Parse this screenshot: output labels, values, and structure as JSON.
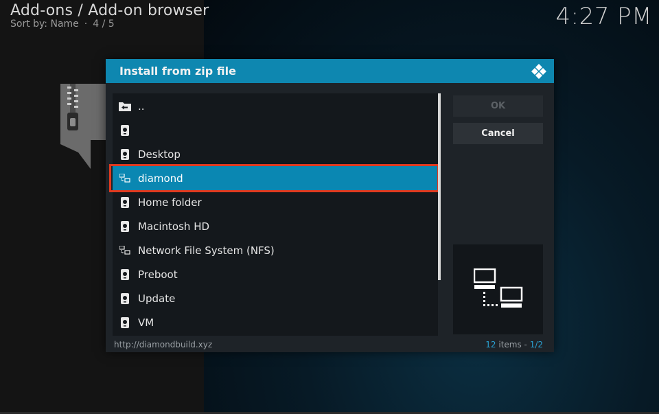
{
  "header": {
    "title": "Add-ons / Add-on browser",
    "sort_label": "Sort by: Name",
    "page_position": "4 / 5",
    "clock": "4:27 PM"
  },
  "dialog": {
    "title": "Install from zip file",
    "items": [
      {
        "label": "..",
        "icon": "back-folder-icon"
      },
      {
        "label": "",
        "icon": "drive-icon"
      },
      {
        "label": "Desktop",
        "icon": "drive-icon"
      },
      {
        "label": "diamond",
        "icon": "network-icon",
        "selected": true
      },
      {
        "label": "Home folder",
        "icon": "drive-icon"
      },
      {
        "label": "Macintosh HD",
        "icon": "drive-icon"
      },
      {
        "label": "Network File System (NFS)",
        "icon": "network-icon"
      },
      {
        "label": "Preboot",
        "icon": "drive-icon"
      },
      {
        "label": "Update",
        "icon": "drive-icon"
      },
      {
        "label": "VM",
        "icon": "drive-icon"
      }
    ],
    "ok_label": "OK",
    "cancel_label": "Cancel",
    "footer_path": "http://diamondbuild.xyz",
    "item_count": "12",
    "item_count_suffix": " items - ",
    "page": "1/2",
    "preview_icon": "network-computers-icon"
  },
  "colors": {
    "accent": "#0e87b0",
    "selection": "#0a87b2",
    "highlight_border": "#e03a1f"
  }
}
